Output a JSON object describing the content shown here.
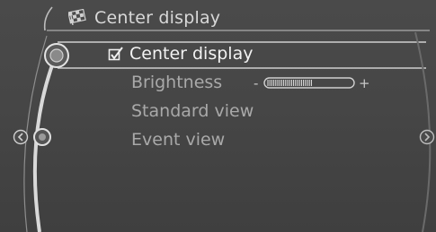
{
  "header": {
    "title": "Center display",
    "icon": "checkered-flag-icon"
  },
  "menu": {
    "items": [
      {
        "label": "Center display",
        "checked": true,
        "selected": true,
        "icon": "checkbox-checked-icon"
      },
      {
        "label": "Brightness",
        "selected": false
      },
      {
        "label": "Standard view",
        "selected": false
      },
      {
        "label": "Event view",
        "selected": false
      }
    ]
  },
  "brightness": {
    "minus": "-",
    "plus": "+",
    "level": 0.55
  },
  "nav": {
    "left_icon": "back-arrow-icon",
    "right_icon": "forward-arrow-icon"
  },
  "colors": {
    "background": "#464646",
    "selected_text": "#f2f2f2",
    "text": "#a9a9a9",
    "arc": "#d6d6d6"
  }
}
